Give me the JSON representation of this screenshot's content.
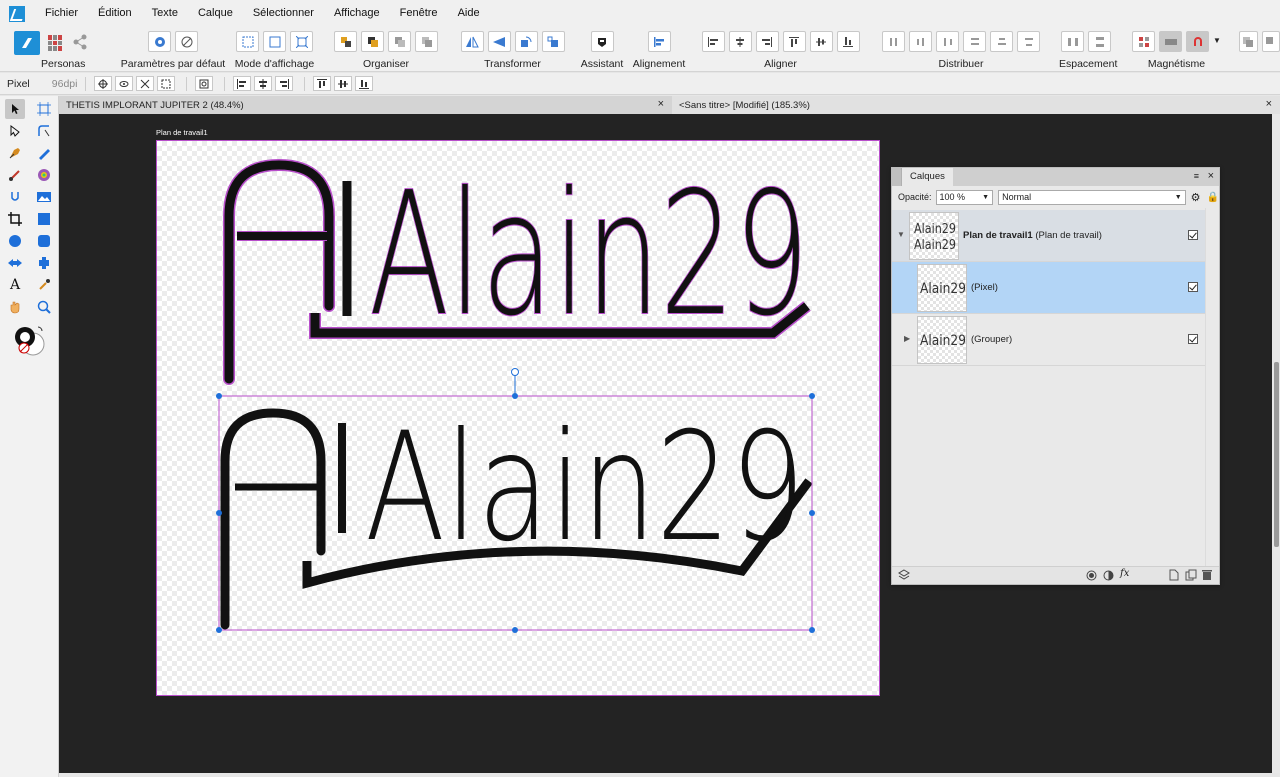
{
  "menu": [
    "Fichier",
    "Édition",
    "Texte",
    "Calque",
    "Sélectionner",
    "Affichage",
    "Fenêtre",
    "Aide"
  ],
  "toolbar": {
    "personas_label": "Personas",
    "params_label": "Paramètres par défaut",
    "view_mode_label": "Mode d'affichage",
    "organize_label": "Organiser",
    "transform_label": "Transformer",
    "assistant_label": "Assistant",
    "alignment_label": "Alignement",
    "align_label": "Aligner",
    "distribute_label": "Distribuer",
    "spacing_label": "Espacement",
    "magnetism_label": "Magnétisme"
  },
  "context": {
    "unit": "Pixel",
    "dpi": "96dpi"
  },
  "tabs": [
    {
      "title": "THETIS IMPLORANT JUPITER 2  (48.4%)",
      "close": "×"
    },
    {
      "title": "<Sans titre> [Modifié] (185.3%)",
      "close": "×"
    }
  ],
  "artboard": {
    "label": "Plan de travail1",
    "text_top": "Alain29",
    "text_bottom": "Alain29"
  },
  "layers": {
    "tab": "Calques",
    "menu_icon": "≡",
    "close": "×",
    "opacity_label": "Opacité:",
    "opacity_value": "100 %",
    "blend_mode": "Normal",
    "items": [
      {
        "name": "Plan de travail1",
        "suffix": "(Plan de travail)",
        "thumb_text": "Alain29",
        "checked": true,
        "expanded": true
      },
      {
        "name": "",
        "suffix": "(Pixel)",
        "thumb_text": "Alain29",
        "checked": true,
        "selected": true
      },
      {
        "name": "",
        "suffix": "(Grouper)",
        "thumb_text": "Alain29",
        "checked": true
      }
    ]
  },
  "colors": {
    "selection": "#1e6fd9",
    "artboard_border": "#b84ecb",
    "layer_selected": "#b3d5f6",
    "canvas_bg": "#232323"
  }
}
